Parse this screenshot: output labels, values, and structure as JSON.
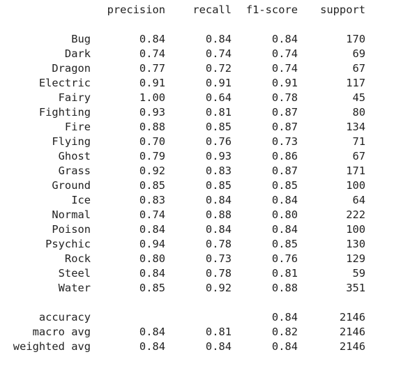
{
  "headers": {
    "precision": "precision",
    "recall": "recall",
    "f1": "f1-score",
    "support": "support"
  },
  "rows": [
    {
      "label": "Bug",
      "precision": "0.84",
      "recall": "0.84",
      "f1": "0.84",
      "support": "170"
    },
    {
      "label": "Dark",
      "precision": "0.74",
      "recall": "0.74",
      "f1": "0.74",
      "support": "69"
    },
    {
      "label": "Dragon",
      "precision": "0.77",
      "recall": "0.72",
      "f1": "0.74",
      "support": "67"
    },
    {
      "label": "Electric",
      "precision": "0.91",
      "recall": "0.91",
      "f1": "0.91",
      "support": "117"
    },
    {
      "label": "Fairy",
      "precision": "1.00",
      "recall": "0.64",
      "f1": "0.78",
      "support": "45"
    },
    {
      "label": "Fighting",
      "precision": "0.93",
      "recall": "0.81",
      "f1": "0.87",
      "support": "80"
    },
    {
      "label": "Fire",
      "precision": "0.88",
      "recall": "0.85",
      "f1": "0.87",
      "support": "134"
    },
    {
      "label": "Flying",
      "precision": "0.70",
      "recall": "0.76",
      "f1": "0.73",
      "support": "71"
    },
    {
      "label": "Ghost",
      "precision": "0.79",
      "recall": "0.93",
      "f1": "0.86",
      "support": "67"
    },
    {
      "label": "Grass",
      "precision": "0.92",
      "recall": "0.83",
      "f1": "0.87",
      "support": "171"
    },
    {
      "label": "Ground",
      "precision": "0.85",
      "recall": "0.85",
      "f1": "0.85",
      "support": "100"
    },
    {
      "label": "Ice",
      "precision": "0.83",
      "recall": "0.84",
      "f1": "0.84",
      "support": "64"
    },
    {
      "label": "Normal",
      "precision": "0.74",
      "recall": "0.88",
      "f1": "0.80",
      "support": "222"
    },
    {
      "label": "Poison",
      "precision": "0.84",
      "recall": "0.84",
      "f1": "0.84",
      "support": "100"
    },
    {
      "label": "Psychic",
      "precision": "0.94",
      "recall": "0.78",
      "f1": "0.85",
      "support": "130"
    },
    {
      "label": "Rock",
      "precision": "0.80",
      "recall": "0.73",
      "f1": "0.76",
      "support": "129"
    },
    {
      "label": "Steel",
      "precision": "0.84",
      "recall": "0.78",
      "f1": "0.81",
      "support": "59"
    },
    {
      "label": "Water",
      "precision": "0.85",
      "recall": "0.92",
      "f1": "0.88",
      "support": "351"
    }
  ],
  "summary": [
    {
      "label": "accuracy",
      "precision": "",
      "recall": "",
      "f1": "0.84",
      "support": "2146"
    },
    {
      "label": "macro avg",
      "precision": "0.84",
      "recall": "0.81",
      "f1": "0.82",
      "support": "2146"
    },
    {
      "label": "weighted avg",
      "precision": "0.84",
      "recall": "0.84",
      "f1": "0.84",
      "support": "2146"
    }
  ]
}
